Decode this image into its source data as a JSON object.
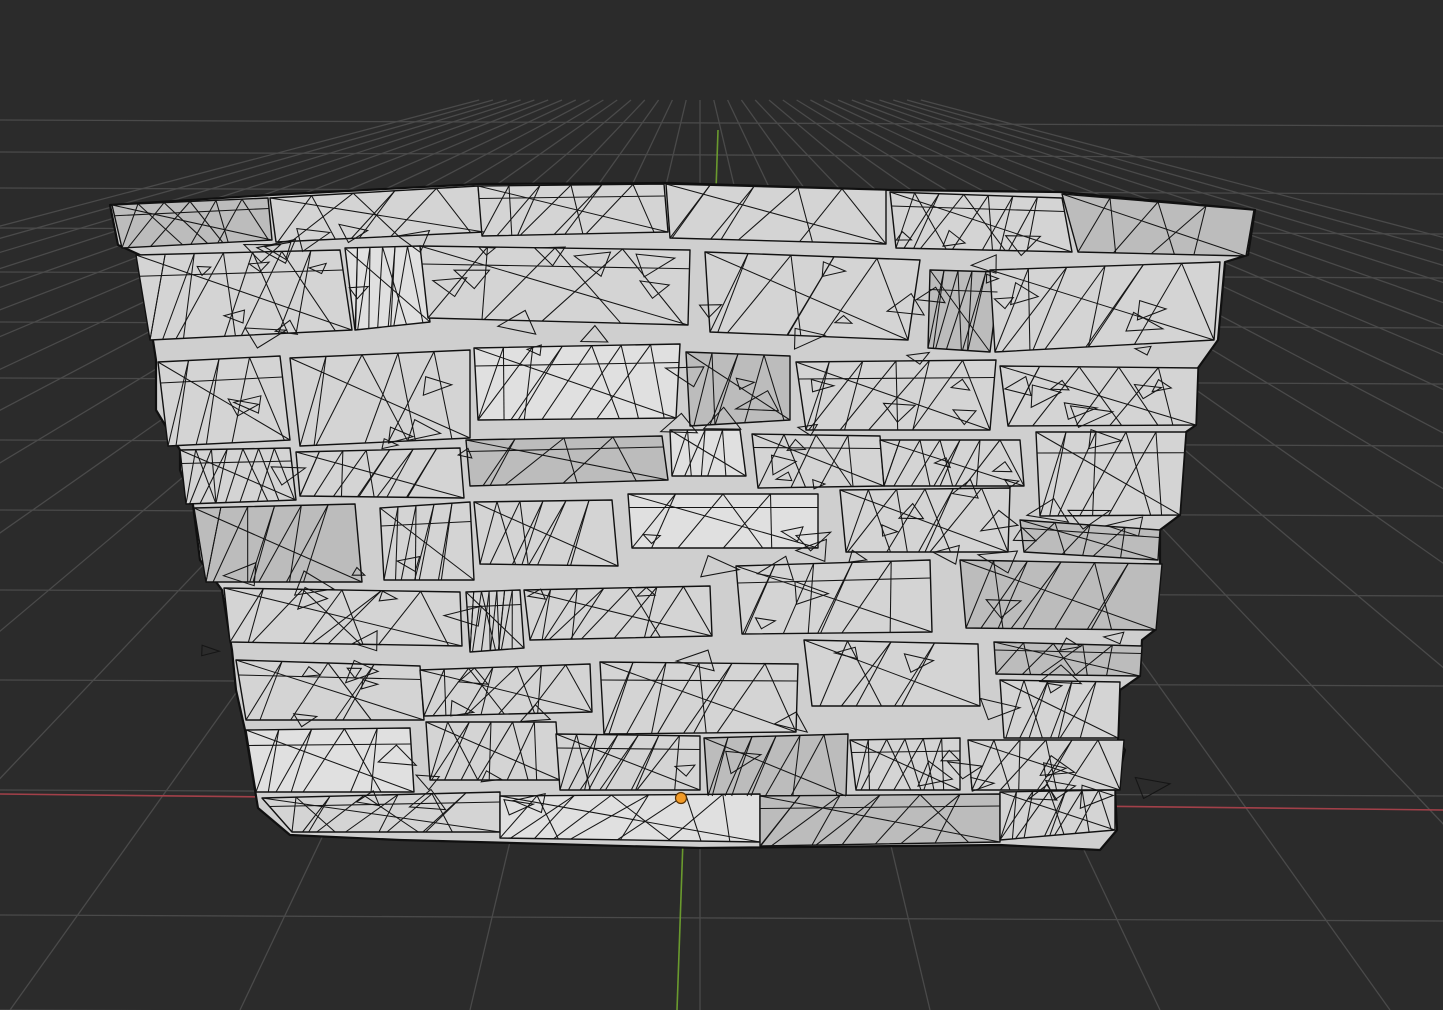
{
  "viewport": {
    "background_color": "#2b2b2b",
    "grid_color": "#4a4a4a",
    "x_axis_color": "#a24049",
    "y_axis_color": "#6a9a2e",
    "view_mode": "wireframe-overlay",
    "origin_point_color": "#f29a26"
  },
  "object": {
    "mesh_icon": "stone-wall-mesh",
    "shade_color": "#d4d4d4",
    "wire_color": "#151515"
  }
}
